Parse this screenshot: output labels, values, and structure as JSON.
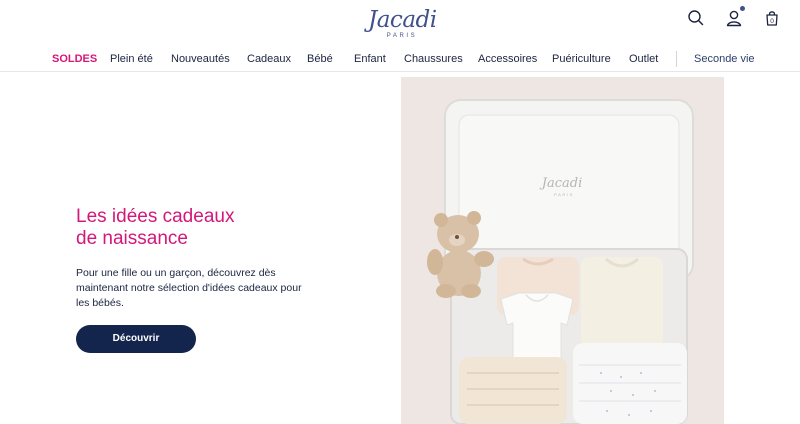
{
  "brand": {
    "name": "Jacadi",
    "tagline": "PARIS"
  },
  "header": {
    "icons": {
      "search": "search-icon",
      "account": "user-icon",
      "bag": "shopping-bag-icon"
    },
    "bag_count": "0"
  },
  "nav": {
    "items": [
      {
        "label": "SOLDES",
        "highlight": true
      },
      {
        "label": "Plein été"
      },
      {
        "label": "Nouveautés"
      },
      {
        "label": "Cadeaux"
      },
      {
        "label": "Bébé"
      },
      {
        "label": "Enfant"
      },
      {
        "label": "Chaussures"
      },
      {
        "label": "Accessoires"
      },
      {
        "label": "Puériculture"
      },
      {
        "label": "Outlet"
      }
    ],
    "secondary": "Seconde vie"
  },
  "hero": {
    "title_line1": "Les idées cadeaux",
    "title_line2": "de naissance",
    "description": "Pour une fille ou un garçon, découvrez dès maintenant notre sélection d'idées cadeaux pour les bébés.",
    "cta_label": "Découvrir",
    "image_brand": "Jacadi",
    "image_brand_sub": "PARIS"
  },
  "colors": {
    "accent": "#d4177a",
    "navy": "#13254c",
    "logo": "#40518c",
    "photo_bg": "#efe7e3"
  }
}
